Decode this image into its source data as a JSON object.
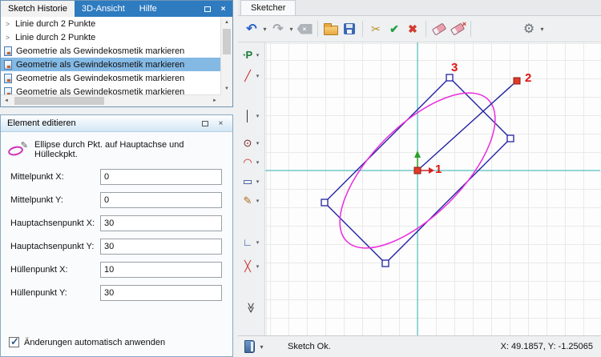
{
  "history_panel": {
    "tabs": [
      "Sketch Historie",
      "3D-Ansicht",
      "Hilfe"
    ],
    "items": [
      {
        "icon": "chevron-right-icon",
        "label": "Linie durch 2 Punkte"
      },
      {
        "icon": "chevron-right-icon",
        "label": "Linie durch 2 Punkte"
      },
      {
        "icon": "geometry-doc-icon",
        "label": "Geometrie als Gewindekosmetik markieren"
      },
      {
        "icon": "geometry-doc-icon",
        "label": "Geometrie als Gewindekosmetik markieren"
      },
      {
        "icon": "geometry-doc-icon",
        "label": "Geometrie als Gewindekosmetik markieren"
      },
      {
        "icon": "geometry-doc-icon",
        "label": "Geometrie als Gewindekosmetik markieren"
      }
    ],
    "selected_index": 3
  },
  "element_panel": {
    "title": "Element editieren",
    "tool_description": "Ellipse durch Pkt. auf Hauptachse und Hülleckpkt.",
    "fields": [
      {
        "label": "Mittelpunkt X:",
        "value": "0"
      },
      {
        "label": "Mittelpunkt Y:",
        "value": "0"
      },
      {
        "label": "Hauptachsenpunkt X:",
        "value": "30"
      },
      {
        "label": "Hauptachsenpunkt Y:",
        "value": "30"
      },
      {
        "label": "Hüllenpunkt X:",
        "value": "10"
      },
      {
        "label": "Hüllenpunkt Y:",
        "value": "30"
      }
    ],
    "auto_apply": {
      "label": "Änderungen automatisch anwenden",
      "checked": true
    }
  },
  "sketcher": {
    "tab": "Sketcher",
    "statusbar": {
      "status": "Sketch Ok.",
      "coordinates": "X: 49.1857, Y: -1.25065"
    },
    "point_labels": {
      "p1": "1",
      "p2": "2",
      "p3": "3"
    },
    "tools": [
      {
        "name": "point-tool",
        "glyph": "∙P"
      },
      {
        "name": "line-tool",
        "glyph": "╱"
      },
      {
        "name": "axis-line-tool",
        "glyph": "│"
      },
      {
        "name": "circle-tool",
        "glyph": "⊙"
      },
      {
        "name": "arc-tool",
        "glyph": "◠"
      },
      {
        "name": "rectangle-tool",
        "glyph": "▭"
      },
      {
        "name": "freehand-tool",
        "glyph": "✎"
      },
      {
        "name": "fillet-tool",
        "glyph": "∟"
      },
      {
        "name": "trim-tool",
        "glyph": "╳"
      },
      {
        "name": "more-tools",
        "glyph": "≫"
      }
    ]
  },
  "icons": {
    "close": "×",
    "caret": "▾ (css)",
    "restore": "css-shape",
    "chevron_item": ">",
    "undo": "↶",
    "redo": "↷",
    "backspace": "css-shape ×",
    "open_folder": "css-shape",
    "save_floppy": "css-shape",
    "cut": "✂",
    "accept": "✔",
    "cancel": "✖",
    "eraser": "css-shape",
    "gear": "⚙",
    "book": "css-shape",
    "scroll_up": "▲",
    "scroll_down": "▼",
    "scroll_left": "◄",
    "scroll_right": "►",
    "backspace_x": "×"
  },
  "colors": {
    "titlebar_blue": "#2e7bc0",
    "selection_blue": "#84b9e4",
    "geometry_navy": "#2121a3",
    "ellipse_magenta": "#ea2cdc",
    "axis_teal": "#38b6b6",
    "label_red": "#e01414"
  }
}
